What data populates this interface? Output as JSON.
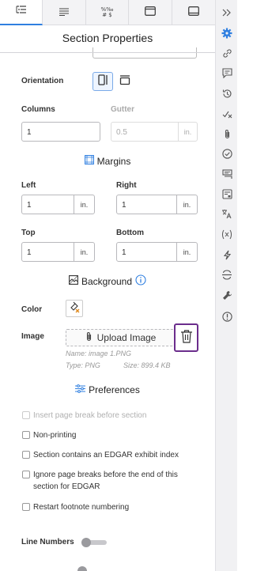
{
  "tabs": [
    {
      "name": "tab-outline",
      "icon": "outline-icon",
      "active": true
    },
    {
      "name": "tab-paragraph",
      "icon": "paragraph-icon",
      "active": false
    },
    {
      "name": "tab-number-format",
      "icon": "number-format-icon",
      "glyph": "%‰\n# $",
      "active": false
    },
    {
      "name": "tab-section",
      "icon": "section-icon",
      "active": false
    },
    {
      "name": "tab-page",
      "icon": "page-icon",
      "active": false
    }
  ],
  "panel_title": "Section Properties",
  "orientation": {
    "label": "Orientation",
    "selected": "portrait"
  },
  "columns": {
    "label": "Columns",
    "value": "1"
  },
  "gutter": {
    "label": "Gutter",
    "value": "0.5",
    "unit": "in."
  },
  "margins": {
    "heading": "Margins",
    "left": {
      "label": "Left",
      "value": "1",
      "unit": "in."
    },
    "right": {
      "label": "Right",
      "value": "1",
      "unit": "in."
    },
    "top": {
      "label": "Top",
      "value": "1",
      "unit": "in."
    },
    "bottom": {
      "label": "Bottom",
      "value": "1",
      "unit": "in."
    }
  },
  "background": {
    "heading": "Background",
    "color_label": "Color",
    "image_label": "Image",
    "upload_label": "Upload Image",
    "file_name": "Name: image 1.PNG",
    "file_type": "Type: PNG",
    "file_size": "Size: 899.4 KB"
  },
  "preferences": {
    "heading": "Preferences",
    "options": [
      {
        "label": "Insert page break before section",
        "checked": false,
        "disabled": true
      },
      {
        "label": "Non-printing",
        "checked": false,
        "disabled": false
      },
      {
        "label": "Section contains an EDGAR exhibit index",
        "checked": false,
        "disabled": false
      },
      {
        "label": "Ignore page breaks before the end of this section for EDGAR",
        "checked": false,
        "disabled": false
      },
      {
        "label": "Restart footnote numbering",
        "checked": false,
        "disabled": false
      }
    ]
  },
  "line_numbers": {
    "label": "Line Numbers",
    "enabled": false
  },
  "rail_icons": [
    "collapse-chevrons-icon",
    "gear-icon",
    "link-icon",
    "comment-icon",
    "history-icon",
    "track-changes-icon",
    "attachment-icon",
    "check-circle-icon",
    "stacked-comments-icon",
    "form-icon",
    "translate-icon",
    "formula-icon",
    "lightning-icon",
    "mask-icon",
    "wrench-icon",
    "alert-icon"
  ],
  "colors": {
    "accent": "#2f7fe0",
    "highlight_border": "#6b2d8c",
    "rail_bg": "#f1f1f3",
    "gear": "#2f7fe0"
  }
}
